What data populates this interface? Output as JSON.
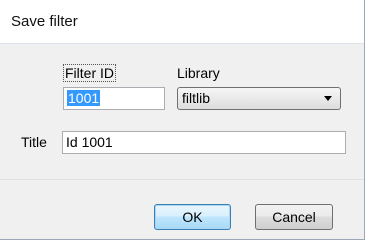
{
  "dialog": {
    "title": "Save filter"
  },
  "form": {
    "filter_id_label": "Filter ID",
    "filter_id_value": "1001",
    "library_label": "Library",
    "library_value": "filtlib",
    "title_label": "Title",
    "title_value": "Id 1001"
  },
  "buttons": {
    "ok_label": "OK",
    "cancel_label": "Cancel"
  },
  "icons": {
    "dropdown": "chevron-down-icon"
  },
  "colors": {
    "selection": "#3399ff",
    "default_button_border": "#3c7fb1"
  }
}
